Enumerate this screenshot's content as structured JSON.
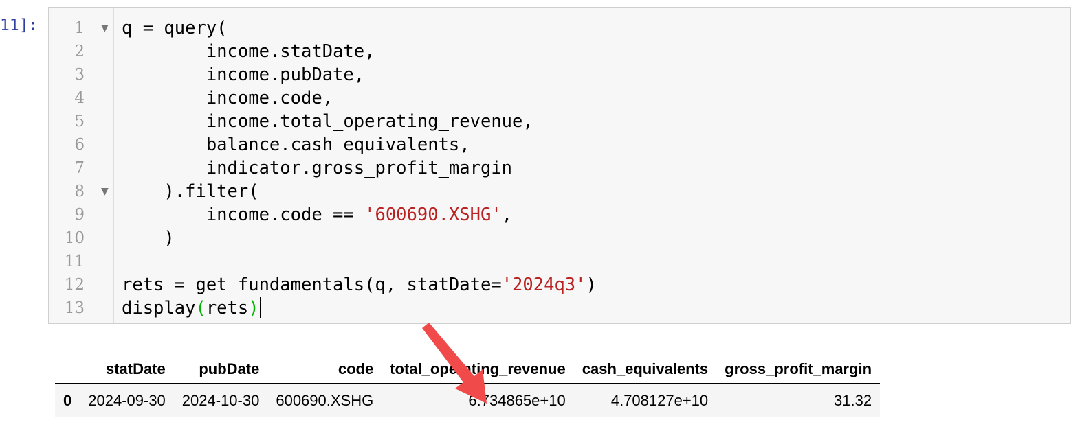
{
  "cell": {
    "prompt": "11]:",
    "lines": [
      {
        "n": "1",
        "fold": true,
        "parts": [
          {
            "t": "q = query("
          }
        ]
      },
      {
        "n": "2",
        "fold": false,
        "parts": [
          {
            "t": "        income.statDate,"
          }
        ]
      },
      {
        "n": "3",
        "fold": false,
        "parts": [
          {
            "t": "        income.pubDate,"
          }
        ]
      },
      {
        "n": "4",
        "fold": false,
        "parts": [
          {
            "t": "        income.code,"
          }
        ]
      },
      {
        "n": "5",
        "fold": false,
        "parts": [
          {
            "t": "        income.total_operating_revenue,"
          }
        ]
      },
      {
        "n": "6",
        "fold": false,
        "parts": [
          {
            "t": "        balance.cash_equivalents,"
          }
        ]
      },
      {
        "n": "7",
        "fold": false,
        "parts": [
          {
            "t": "        indicator.gross_profit_margin"
          }
        ]
      },
      {
        "n": "8",
        "fold": true,
        "parts": [
          {
            "t": "    ).filter("
          }
        ]
      },
      {
        "n": "9",
        "fold": false,
        "parts": [
          {
            "t": "        income.code == "
          },
          {
            "t": "'600690.XSHG'",
            "c": "str"
          },
          {
            "t": ","
          }
        ]
      },
      {
        "n": "10",
        "fold": false,
        "parts": [
          {
            "t": "    )"
          }
        ]
      },
      {
        "n": "11",
        "fold": false,
        "parts": []
      },
      {
        "n": "12",
        "fold": false,
        "parts": [
          {
            "t": "rets = get_fundamentals(q, statDate="
          },
          {
            "t": "'2024q3'",
            "c": "str"
          },
          {
            "t": ")"
          }
        ]
      },
      {
        "n": "13",
        "fold": false,
        "cursor": true,
        "parts": [
          {
            "t": "display"
          },
          {
            "t": "(",
            "c": "bm"
          },
          {
            "t": "rets"
          },
          {
            "t": ")",
            "c": "bm"
          }
        ]
      }
    ]
  },
  "output": {
    "columns": [
      "",
      "statDate",
      "pubDate",
      "code",
      "total_operating_revenue",
      "cash_equivalents",
      "gross_profit_margin"
    ],
    "rows": [
      [
        "0",
        "2024-09-30",
        "2024-10-30",
        "600690.XSHG",
        "6.734865e+10",
        "4.708127e+10",
        "31.32"
      ]
    ]
  },
  "annotation": {
    "arrow_color": "#f04a4a"
  },
  "colors": {
    "prompt": "#303f9f",
    "string": "#ba2121",
    "bracket_match": "#00b400",
    "line_number": "#999999",
    "cell_background": "#f7f7f7"
  }
}
